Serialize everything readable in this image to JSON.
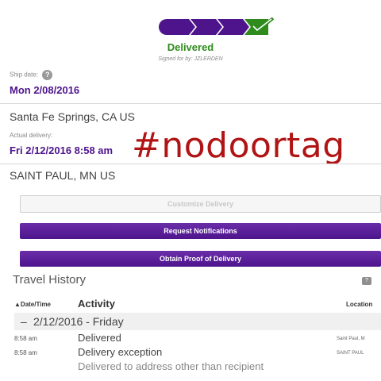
{
  "status": {
    "label": "Delivered",
    "signed_for": "Signed for by: JZLERDEN",
    "progress_steps_complete": 4,
    "progress_steps_total": 4,
    "progress_color": "#4d148c",
    "complete_color": "#2e8b1c"
  },
  "shipment": {
    "ship_date_label": "Ship date:",
    "ship_date": "Mon 2/08/2016",
    "origin": "Santa Fe Springs, CA US",
    "actual_delivery_label": "Actual delivery:",
    "actual_delivery": "Fri 2/12/2016 8:58 am",
    "destination": "SAINT PAUL, MN US"
  },
  "overlay": {
    "hashtag": "#nodoortag",
    "color": "#b11414"
  },
  "buttons": {
    "customize": "Customize Delivery",
    "notifications": "Request Notifications",
    "proof": "Obtain Proof of Delivery"
  },
  "travel_history": {
    "title": "Travel History",
    "columns": {
      "date": "▲Date/Time",
      "activity": "Activity",
      "location": "Location"
    },
    "day": "2/12/2016 - Friday",
    "events": [
      {
        "time": "8:58 am",
        "activity": "Delivered",
        "location": "Saint Paul, M"
      },
      {
        "time": "8:58 am",
        "activity": "Delivery exception",
        "location": "SAINT PAUL",
        "detail": "Delivered to address other than recipient"
      }
    ]
  }
}
